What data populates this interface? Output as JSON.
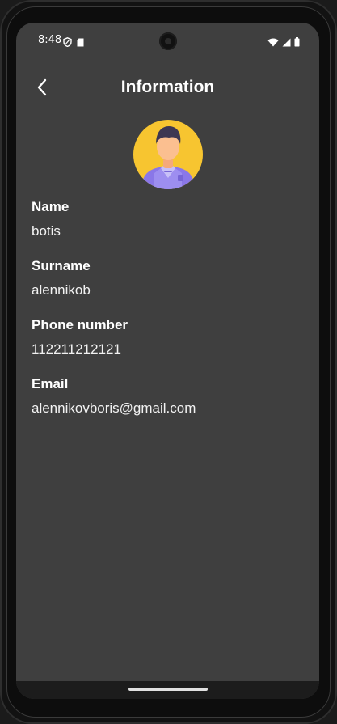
{
  "status_bar": {
    "time": "8:48",
    "left_icons": [
      "shield-icon",
      "sim-card-icon"
    ],
    "right_icons": [
      "wifi-icon",
      "signal-icon",
      "battery-icon"
    ]
  },
  "header": {
    "title": "Information",
    "back_icon": "chevron-left-icon"
  },
  "profile": {
    "avatar": "user-avatar-icon",
    "fields": [
      {
        "label": "Name",
        "value": "botis"
      },
      {
        "label": "Surname",
        "value": "alennikob"
      },
      {
        "label": "Phone number",
        "value": "112211212121"
      },
      {
        "label": "Email",
        "value": "alennikovboris@gmail.com"
      }
    ]
  },
  "colors": {
    "background": "#3f3f3f",
    "text": "#ffffff",
    "avatar_bg": "#f7c530",
    "shirt": "#8a77e8"
  }
}
